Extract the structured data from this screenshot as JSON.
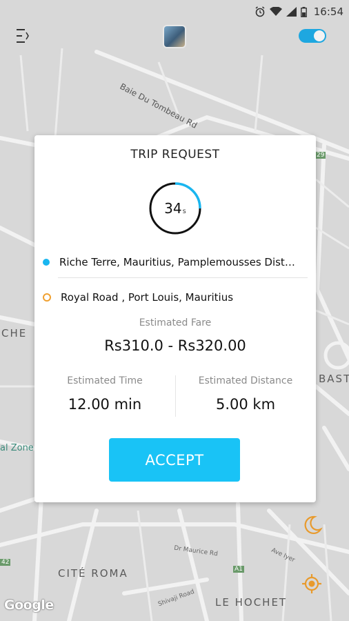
{
  "status_bar": {
    "time": "16:54",
    "icons": [
      "alarm-icon",
      "wifi-icon",
      "signal-icon",
      "battery-icon"
    ]
  },
  "header": {
    "menu_icon": "menu-icon",
    "avatar": "user-avatar",
    "toggle_state": "on",
    "accent": "#1ea7e0"
  },
  "map": {
    "labels": {
      "road_baie": "Baie Du Tombeau Rd",
      "che": "CHE",
      "bast": "BAST",
      "zone": "al Zone",
      "cite_roma": "CITÉ ROMA",
      "le_hochet": "LE HOCHET",
      "dr_maurice": "Dr Maurice Rd",
      "ave_lyer": "Ave Iyer",
      "shivaji": "Shivaji Road",
      "a1": "A1",
      "a29": "29",
      "a42": "42"
    },
    "google": "Google"
  },
  "trip": {
    "title": "TRIP REQUEST",
    "countdown": "34",
    "countdown_unit": "s",
    "countdown_progress": 0.25,
    "pickup": "Riche Terre, Mauritius, Pamplemousses Dist…",
    "dropoff": "Royal Road , Port Louis, Mauritius",
    "fare_label": "Estimated Fare",
    "fare_value": "Rs310.0 - Rs320.00",
    "time_label": "Estimated Time",
    "time_value": "12.00 min",
    "distance_label": "Estimated Distance",
    "distance_value": "5.00 km",
    "accept_label": "ACCEPT",
    "colors": {
      "accept": "#19c3f6",
      "pickup_dot": "#19b6f0",
      "dropoff_dot": "#f0a030"
    }
  },
  "fabs": [
    "night-mode-icon",
    "locate-me-icon"
  ]
}
